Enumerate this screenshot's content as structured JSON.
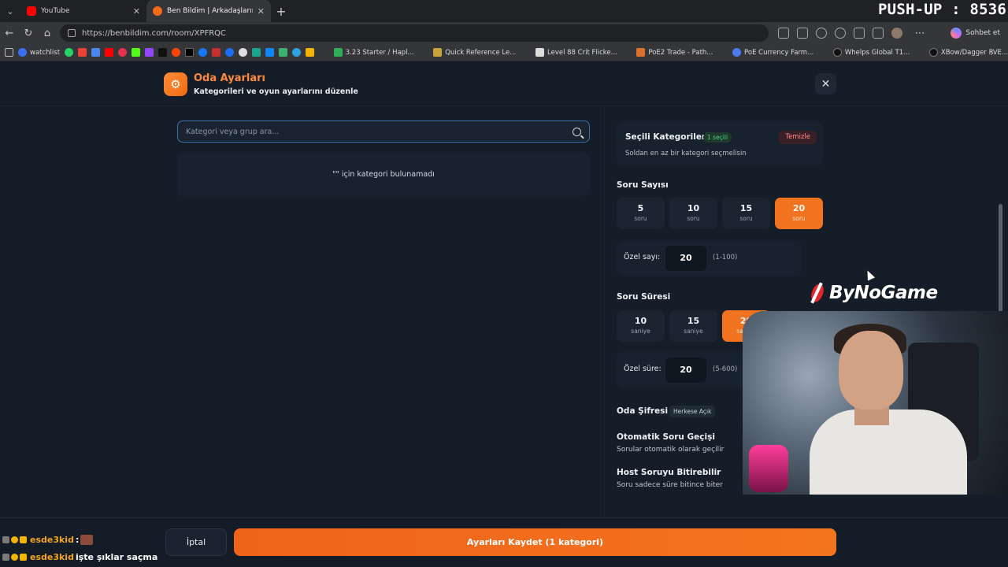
{
  "browser": {
    "tabs": [
      {
        "title": "YouTube",
        "favicon_color": "#ff0000"
      },
      {
        "title": "Ben Bildim | Arkadaşlarınla Online",
        "favicon_color": "#f26a12"
      }
    ],
    "url": "https://benbildim.com/room/XPFRQC",
    "chat_button": "Sohbet et",
    "bookmarks": [
      {
        "label": "watchlist",
        "color": "#3a6ff0"
      },
      {
        "label": "3.23 Starter / Hapl...",
        "color": "#2fae56"
      },
      {
        "label": "Quick Reference Le...",
        "color": "#c9a23a"
      },
      {
        "label": "Level 88 Crit Flicke...",
        "color": "#ddd"
      },
      {
        "label": "PoE2 Trade - Path...",
        "color": "#d9722b"
      },
      {
        "label": "PoE Currency Farm...",
        "color": "#4a7cf0"
      },
      {
        "label": "Whelps Global T1...",
        "color": "#111"
      },
      {
        "label": "XBow/Dagger PVE...",
        "color": "#111"
      }
    ]
  },
  "overlay": {
    "pushup": "PUSH-UP : 8536",
    "sponsor": "ByNoGame",
    "chat": [
      {
        "user": "esde3kid",
        "message": ":"
      },
      {
        "user": "esde3kid",
        "message": "işte şıklar saçma"
      }
    ]
  },
  "modal": {
    "title": "Oda Ayarları",
    "subtitle": "Kategorileri ve oyun ayarlarını düzenle",
    "search_placeholder": "Kategori veya grup ara...",
    "empty_text": "\"\" için kategori bulunamadı",
    "selected": {
      "title": "Seçili Kategoriler",
      "badge": "1 seçili",
      "clear": "Temizle",
      "hint": "Soldan en az bir kategori seçmelisin"
    },
    "question_count": {
      "label": "Soru Sayısı",
      "options": [
        {
          "n": "5",
          "u": "soru"
        },
        {
          "n": "10",
          "u": "soru"
        },
        {
          "n": "15",
          "u": "soru"
        },
        {
          "n": "20",
          "u": "soru"
        }
      ],
      "active_index": 3,
      "custom_label": "Özel sayı:",
      "custom_value": "20",
      "custom_range": "(1-100)"
    },
    "question_time": {
      "label": "Soru Süresi",
      "options": [
        {
          "n": "10",
          "u": "saniye"
        },
        {
          "n": "15",
          "u": "saniye"
        },
        {
          "n": "20",
          "u": "saniye"
        }
      ],
      "active_index": 2,
      "custom_label": "Özel süre:",
      "custom_value": "20",
      "custom_range": "(5-600)"
    },
    "password": {
      "label": "Oda Şifresi",
      "badge": "Herkese Açık"
    },
    "auto_next": {
      "title": "Otomatik Soru Geçişi",
      "desc": "Sorular otomatik olarak geçilir"
    },
    "host_end": {
      "title": "Host Soruyu Bitirebilir",
      "desc": "Soru sadece süre bitince biter"
    },
    "cancel": "İptal",
    "save": "Ayarları Kaydet (1 kategori)"
  }
}
